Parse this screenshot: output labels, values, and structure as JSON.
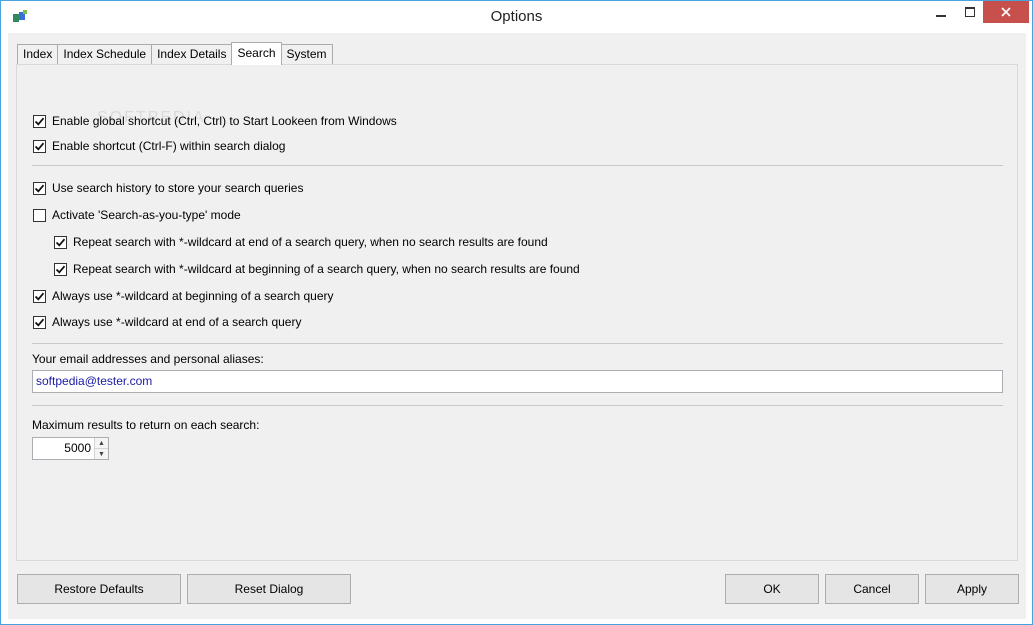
{
  "window": {
    "title": "Options",
    "minimize_icon": "minimize-icon",
    "maximize_icon": "maximize-icon",
    "close_icon": "close-icon",
    "close_color": "#c7504c",
    "accent_border": "#4aa3df"
  },
  "tabs": [
    {
      "label": "Index",
      "active": false
    },
    {
      "label": "Index Schedule",
      "active": false
    },
    {
      "label": "Index Details",
      "active": false
    },
    {
      "label": "Search",
      "active": true
    },
    {
      "label": "System",
      "active": false
    }
  ],
  "search": {
    "options": [
      {
        "label": "Enable global shortcut (Ctrl, Ctrl) to Start Lookeen from Windows",
        "checked": true
      },
      {
        "label": "Enable shortcut (Ctrl-F) within search dialog",
        "checked": true
      },
      {
        "label": "Use search history to store your search queries",
        "checked": true
      },
      {
        "label": "Activate 'Search-as-you-type' mode",
        "checked": false
      },
      {
        "label": "Repeat search with *-wildcard at end of a search query, when no search results are found",
        "checked": true
      },
      {
        "label": "Repeat search with *-wildcard at beginning of a search query, when no search results are found",
        "checked": true
      },
      {
        "label": "Always use *-wildcard at beginning of a search query",
        "checked": true
      },
      {
        "label": "Always use *-wildcard at end of a search query",
        "checked": true
      }
    ],
    "email_label": "Your email addresses and personal aliases:",
    "email_value": "softpedia@tester.com",
    "max_results_label": "Maximum results to return on each search:",
    "max_results_value": "5000",
    "watermark": "SOFTPEDIA"
  },
  "buttons": {
    "restore_defaults": "Restore Defaults",
    "reset_dialog": "Reset Dialog",
    "ok": "OK",
    "cancel": "Cancel",
    "apply": "Apply"
  }
}
